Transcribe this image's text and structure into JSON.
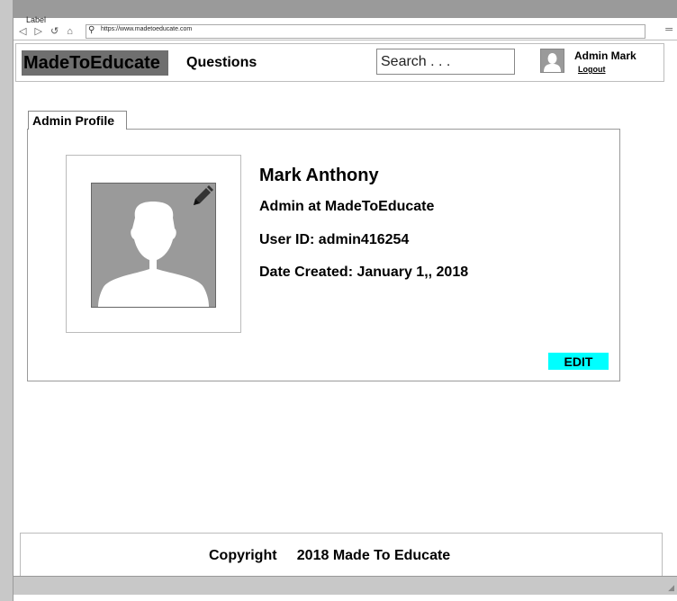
{
  "browser": {
    "tab_label": "Label",
    "url": "https://www.madetoeducate.com",
    "nav_icons": "◁ ▷ ↺ ⌂",
    "menu_icon": "═"
  },
  "header": {
    "logo": "MadeToEducate",
    "nav_questions": "Questions",
    "search_placeholder": "Search . . .",
    "user_name": "Admin Mark",
    "logout": "Logout"
  },
  "profile": {
    "tab_label": "Admin Profile",
    "full_name": "Mark Anthony",
    "role": "Admin at MadeToEducate",
    "user_id": "User ID: admin416254",
    "date_created": "Date Created: January 1,, 2018",
    "edit_label": "EDIT"
  },
  "footer": {
    "copyright": "Copyright     2018 Made To Educate"
  },
  "colors": {
    "edit_button": "#00ffff",
    "logo_background": "#6f6f6f",
    "avatar_background": "#9a9a9a"
  }
}
